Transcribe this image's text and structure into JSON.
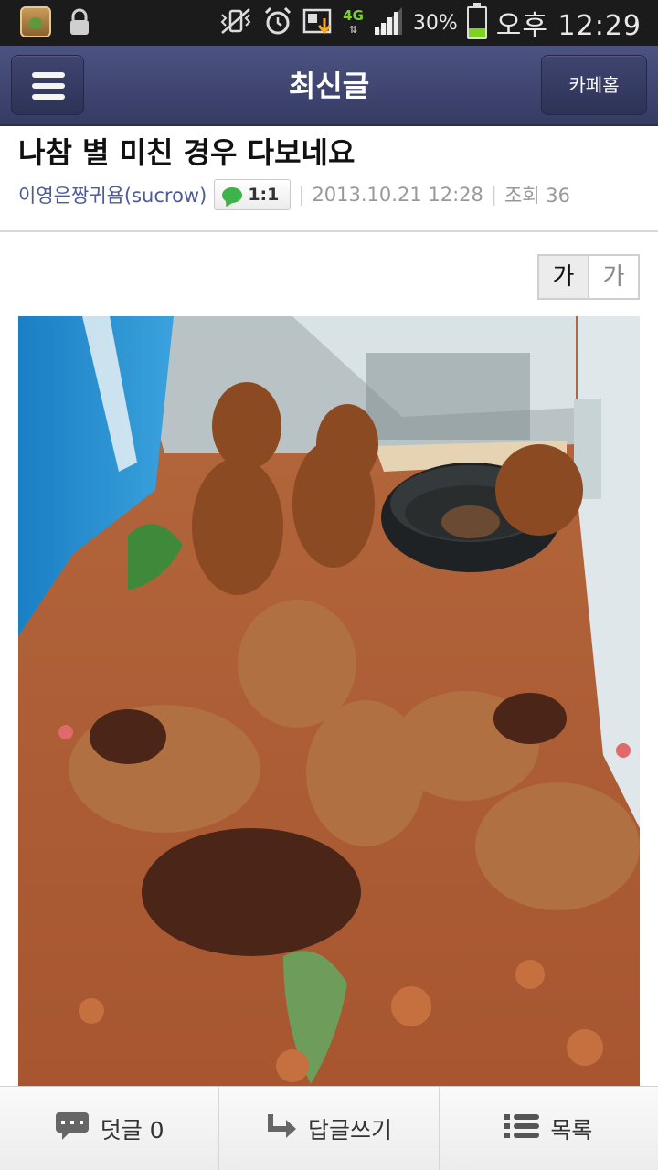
{
  "status_bar": {
    "network": "4G",
    "battery_percent_label": "30%",
    "battery_level": 0.3,
    "time": "오후 12:29",
    "icons": [
      "gallery-icon",
      "lock-icon",
      "vibrate-off-icon",
      "alarm-icon",
      "download-icon",
      "4g-icon",
      "signal-icon",
      "battery-icon"
    ]
  },
  "header": {
    "title": "최신글",
    "menu_icon": "hamburger-icon",
    "cafe_home_label": "카페홈"
  },
  "post": {
    "title": "나참 별 미친 경우 다보네요",
    "author": "이영은짱귀욤(sucrow)",
    "chat_button_label": "1:1",
    "date": "2013.10.21 12:28",
    "views_label": "조회 36"
  },
  "font_toggle": {
    "small_label": "가",
    "large_label": "가"
  },
  "bottom_bar": {
    "comments_label": "덧글 0",
    "reply_label": "답글쓰기",
    "list_label": "목록"
  }
}
